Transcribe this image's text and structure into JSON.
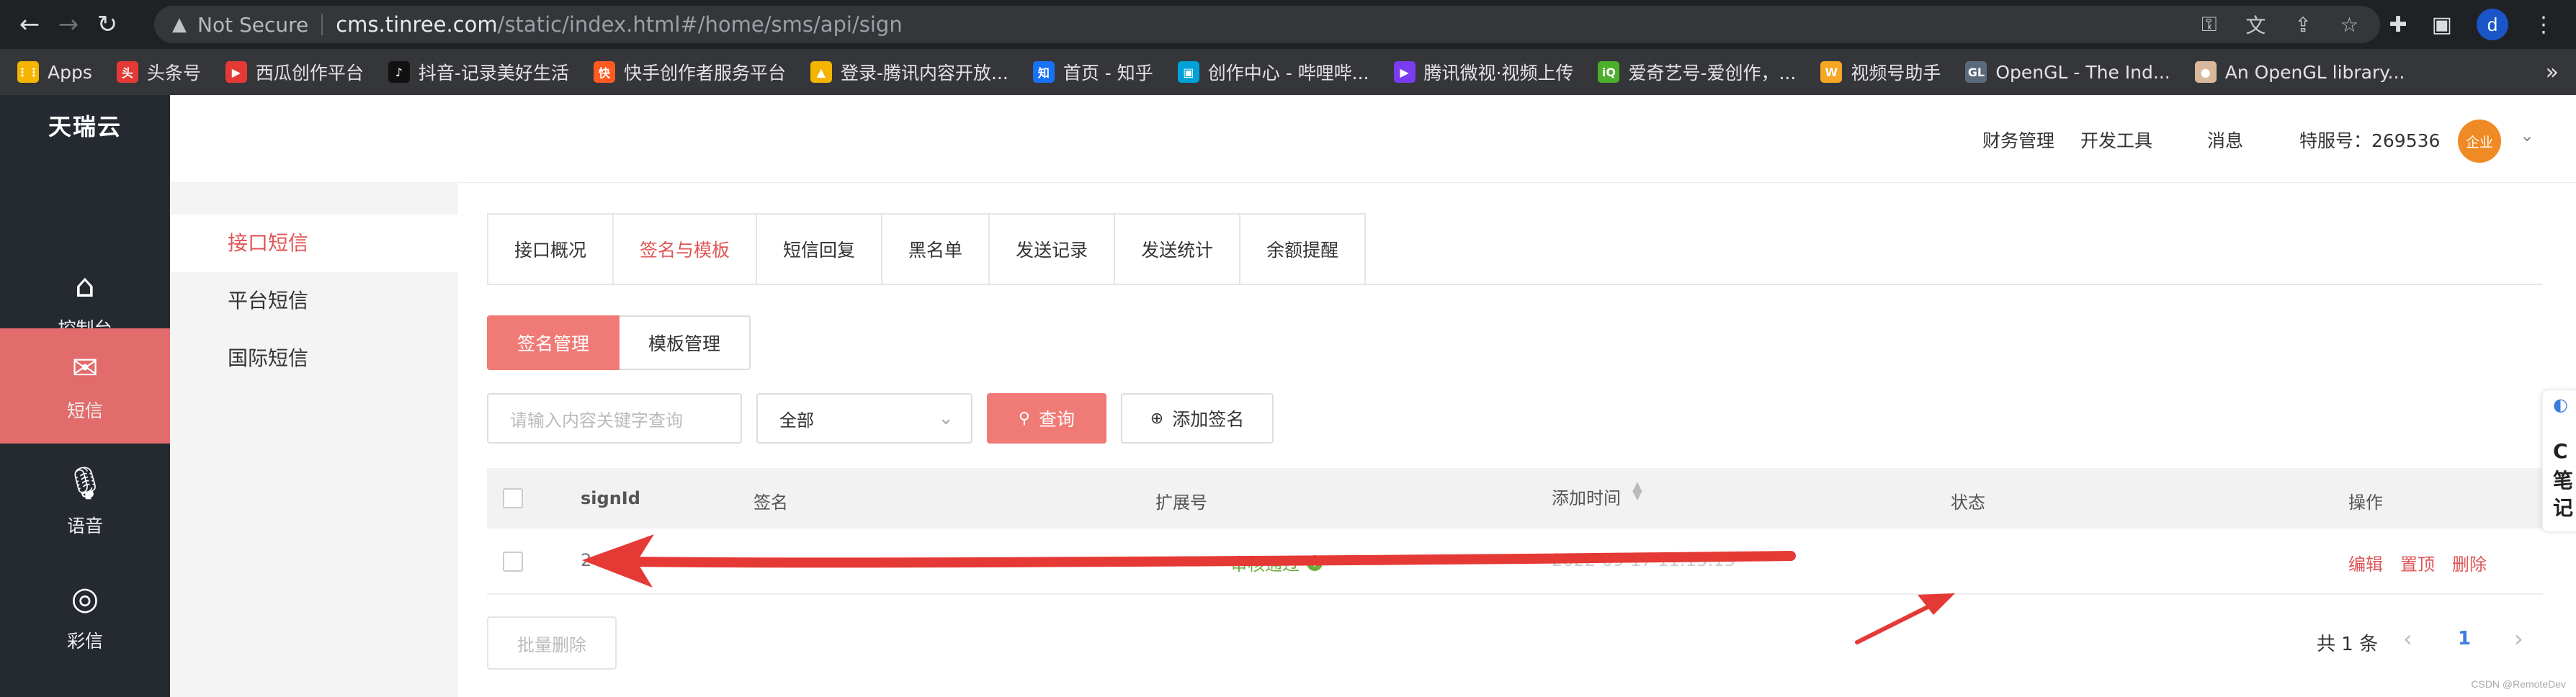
{
  "browser": {
    "not_secure": "Not Secure",
    "url_host": "cms.tinree.com",
    "url_path": "/static/index.html#/home/sms/api/sign",
    "profile_initial": "d"
  },
  "bookmarks": [
    {
      "label": "Apps",
      "color": "#f4b400",
      "glyph": "⋮⋮"
    },
    {
      "label": "头条号",
      "color": "#e53935",
      "glyph": "头"
    },
    {
      "label": "西瓜创作平台",
      "color": "#e53935",
      "glyph": "▶"
    },
    {
      "label": "抖音-记录美好生活",
      "color": "#111111",
      "glyph": "♪"
    },
    {
      "label": "快手创作者服务平台",
      "color": "#ff5a1f",
      "glyph": "快"
    },
    {
      "label": "登录-腾讯内容开放...",
      "color": "#f4b400",
      "glyph": "▲"
    },
    {
      "label": "首页 - 知乎",
      "color": "#1772f6",
      "glyph": "知"
    },
    {
      "label": "创作中心 - 哔哩哔...",
      "color": "#00a1d6",
      "glyph": "▣"
    },
    {
      "label": "腾讯微视·视频上传",
      "color": "#7a3cf0",
      "glyph": "▶"
    },
    {
      "label": "爱奇艺号-爱创作，...",
      "color": "#4caf2b",
      "glyph": "iQ"
    },
    {
      "label": "视频号助手",
      "color": "#f6a623",
      "glyph": "W"
    },
    {
      "label": "OpenGL - The Ind...",
      "color": "#5b6a7a",
      "glyph": "GL"
    },
    {
      "label": "An OpenGL library...",
      "color": "#d9b99b",
      "glyph": "●"
    }
  ],
  "sidebar": {
    "brand": "天瑞云",
    "items": [
      {
        "label": "控制台",
        "icon": "home-icon"
      },
      {
        "label": "短信",
        "icon": "mail-icon"
      },
      {
        "label": "语音",
        "icon": "microphone-icon"
      },
      {
        "label": "彩信",
        "icon": "chart-circle-icon"
      }
    ]
  },
  "header": {
    "links": [
      "财务管理",
      "开发工具",
      "消息"
    ],
    "service_no": "特服号：269536",
    "avatar_text": "企业"
  },
  "submenu": {
    "items": [
      "接口短信",
      "平台短信",
      "国际短信"
    ]
  },
  "tabs": [
    "接口概况",
    "签名与模板",
    "短信回复",
    "黑名单",
    "发送记录",
    "发送统计",
    "余额提醒"
  ],
  "segment": [
    "签名管理",
    "模板管理"
  ],
  "filters": {
    "search_placeholder": "请输入内容关键字查询",
    "select_value": "全部",
    "query_label": "查询",
    "add_label": "添加签名"
  },
  "table": {
    "headers": [
      "signId",
      "签名",
      "扩展号",
      "添加时间",
      "状态",
      "操作"
    ],
    "row": {
      "signid": "2",
      "time": "2022-09-17 11:13:13",
      "status": "审核通过",
      "ops": [
        "编辑",
        "置顶",
        "删除"
      ]
    }
  },
  "footer": {
    "batch_delete": "批量删除",
    "total": "共 1 条",
    "page": "1"
  },
  "float_widget": [
    "C",
    "笔",
    "记"
  ],
  "watermark": "CSDN @RemoteDev",
  "colors": {
    "accent": "#e05555",
    "sidebar_bg": "#252a31",
    "active_menu": "#e26b6b",
    "success": "#6cae3c",
    "annotation": "#e53935"
  }
}
